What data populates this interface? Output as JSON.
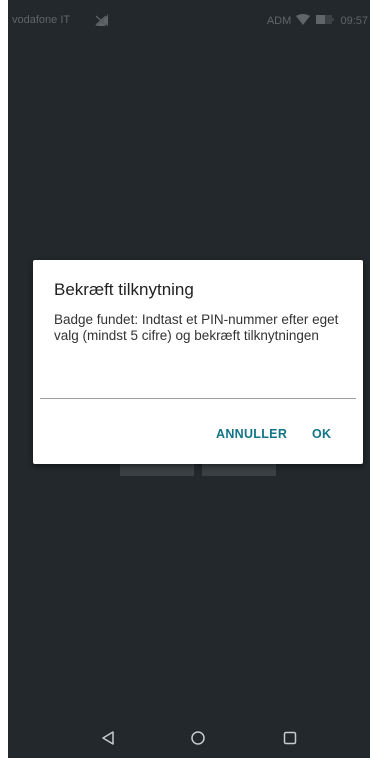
{
  "status_bar": {
    "carrier": "vodafone IT",
    "right_text": "ADM",
    "time": "09:57",
    "icons": [
      "no-sim-icon",
      "wifi-icon",
      "battery-icon"
    ]
  },
  "dialog": {
    "title": "Bekræft tilknytning",
    "message": "Badge fundet: Indtast et PIN-nummer efter eget valg (mindst 5 cifre) og bekræft tilknytningen",
    "input_value": "",
    "cancel_label": "ANNULLER",
    "ok_label": "OK"
  },
  "nav_bar": {
    "icons": [
      "back-icon",
      "home-icon",
      "recent-apps-icon"
    ]
  },
  "colors": {
    "background": "#22282b",
    "accent": "#127587",
    "dialog": "#ffffff"
  }
}
